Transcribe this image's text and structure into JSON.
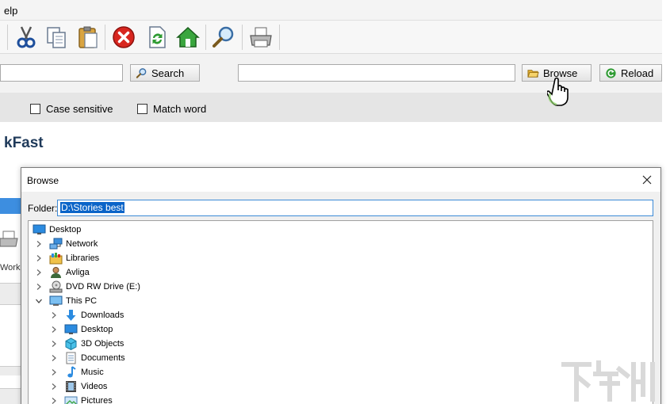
{
  "menubar": {
    "items": [
      {
        "label": "elp"
      }
    ]
  },
  "toolbar": {
    "buttons": [
      {
        "name": "cut-icon"
      },
      {
        "name": "copy-icon"
      },
      {
        "name": "paste-icon"
      },
      {
        "name": "stop-icon"
      },
      {
        "name": "refresh-icon"
      },
      {
        "name": "home-icon"
      },
      {
        "name": "find-icon"
      },
      {
        "name": "print-icon"
      }
    ]
  },
  "search": {
    "query_value": "",
    "search_label": "Search",
    "path_value": "",
    "browse_label": "Browse",
    "reload_label": "Reload"
  },
  "options": {
    "case_sensitive": "Case sensitive",
    "match_word": "Match word"
  },
  "app": {
    "title_fragment": "kFast",
    "left_text": "Work"
  },
  "dialog": {
    "title": "Browse",
    "folder_label": "Folder:",
    "folder_value": "D:\\Stories best",
    "tree": [
      {
        "label": "Desktop",
        "icon": "desktop-icon"
      },
      {
        "label": "Network",
        "icon": "network-icon"
      },
      {
        "label": "Libraries",
        "icon": "libraries-icon"
      },
      {
        "label": "Avliga",
        "icon": "user-icon"
      },
      {
        "label": "DVD RW Drive (E:)",
        "icon": "dvd-drive-icon"
      },
      {
        "label": "This PC",
        "icon": "this-pc-icon"
      },
      {
        "label": "Downloads",
        "icon": "downloads-icon"
      },
      {
        "label": "Desktop",
        "icon": "desktop-icon"
      },
      {
        "label": "3D Objects",
        "icon": "3d-objects-icon"
      },
      {
        "label": "Documents",
        "icon": "documents-icon"
      },
      {
        "label": "Music",
        "icon": "music-icon"
      },
      {
        "label": "Videos",
        "icon": "videos-icon"
      },
      {
        "label": "Pictures",
        "icon": "pictures-icon"
      }
    ]
  },
  "colors": {
    "accent": "#0a64c8",
    "title_text": "#1f3a5a",
    "selection_border": "#3c8ad6"
  }
}
